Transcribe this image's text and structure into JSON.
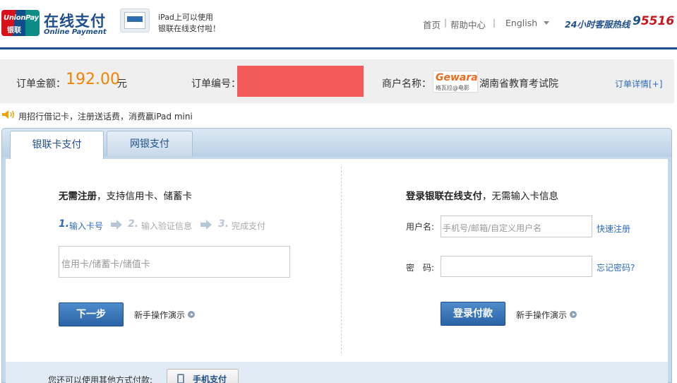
{
  "header": {
    "logo": {
      "line1": "UnionPay",
      "line2": "银联"
    },
    "brand_cn": "在线支付",
    "brand_en": "Online Payment",
    "promo": {
      "line1": "iPad上可以使用",
      "line2": "银联在线支付啦！"
    },
    "nav": {
      "home": "首页",
      "help": "帮助中心",
      "sep1": "|",
      "sep2": "|",
      "language": "English"
    },
    "hotline_label": "24小时客服热线",
    "hotline_number_a": "9",
    "hotline_number_b": "5516"
  },
  "order": {
    "amount_label": "订单金额：",
    "amount": "192.00",
    "unit": "元",
    "number_label": "订单编号：",
    "merchant_label": "商户名称：",
    "merchant_logo_line1": "Gewara",
    "merchant_logo_line2": "格瓦拉@电影",
    "merchant_name": "湖南省教育考试院",
    "detail_link": "订单详情[+]"
  },
  "notice": "用招行借记卡，注册送话费，消费赢iPad mini",
  "tabs": [
    {
      "label": "银联卡支付",
      "active": true
    },
    {
      "label": "网银支付",
      "active": false
    }
  ],
  "left": {
    "title_bold": "无需注册",
    "title_rest": "，支持信用卡、储蓄卡",
    "steps": [
      {
        "num": "1.",
        "label": "输入卡号",
        "active": true
      },
      {
        "num": "2.",
        "label": "输入验证信息",
        "active": false
      },
      {
        "num": "3.",
        "label": "完成支付",
        "active": false
      }
    ],
    "card_placeholder": "信用卡/储蓄卡/储值卡",
    "next_button": "下一步",
    "guide": "新手操作演示"
  },
  "right": {
    "title_bold": "登录银联在线支付",
    "title_rest": "，无需输入卡信息",
    "username_label": "用户名:",
    "username_placeholder": "手机号/邮箱/自定义用户名",
    "quick_register": "快速注册",
    "password_label": "密　码:",
    "forgot_password": "忘记密码?",
    "login_button": "登录付款",
    "guide": "新手操作演示"
  },
  "bottom": {
    "other_text": "您还可以使用其他方式付款:",
    "mobile_button": "手机支付"
  },
  "colors": {
    "brand_blue": "#1f4e8c",
    "amount_orange": "#f08300",
    "redaction": "#f55a5a",
    "link": "#2e6bb8"
  }
}
